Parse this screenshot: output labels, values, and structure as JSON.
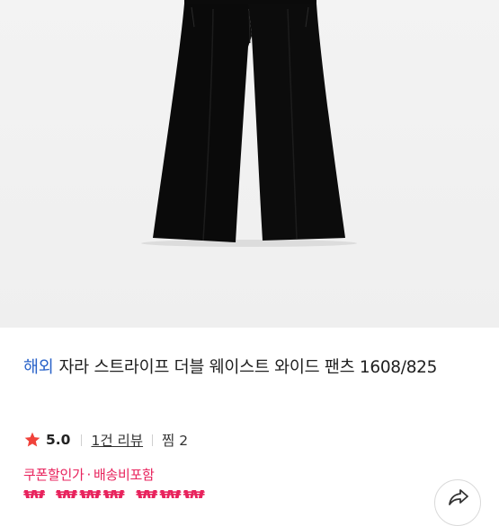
{
  "product": {
    "badge": "해외",
    "title": "자라 스트라이프 더블 웨이스트 와이드 팬츠 1608/825",
    "rating": "5.0",
    "reviews": "1건 리뷰",
    "likes": "찜 2",
    "coupon_label": "쿠폰할인가",
    "shipping_label": "배송비포함",
    "coupon_separator": "·",
    "price_partial": "₩ ₩₩₩,₩₩₩₩"
  },
  "colors": {
    "badge": "#2a63c9",
    "accent": "#e8235d",
    "star": "#f0423a"
  },
  "icons": {
    "rating": "star-icon",
    "share": "share-icon"
  }
}
